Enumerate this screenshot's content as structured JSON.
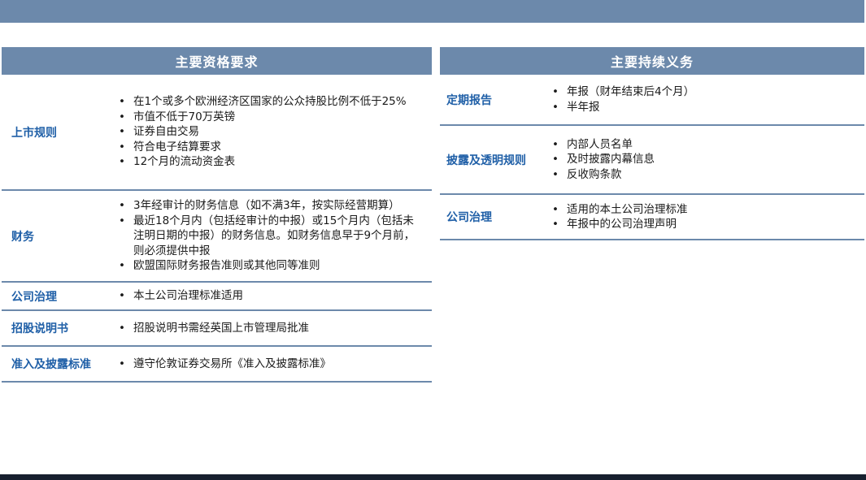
{
  "left_panel": {
    "title": "主要资格要求",
    "rows": [
      {
        "label": "上市规则",
        "items": [
          "在1个或多个欧洲经济区国家的公众持股比例不低于25%",
          "市值不低于70万英镑",
          "证券自由交易",
          "符合电子结算要求",
          "12个月的流动资金表"
        ]
      },
      {
        "label": "财务",
        "items": [
          "3年经审计的财务信息（如不满3年，按实际经营期算）",
          "最近18个月内（包括经审计的中报）或15个月内（包括未注明日期的中报）的财务信息。如财务信息早于9个月前，则必须提供中报",
          "欧盟国际财务报告准则或其他同等准则"
        ]
      },
      {
        "label": "公司治理",
        "items": [
          "本土公司治理标准适用"
        ]
      },
      {
        "label": "招股说明书",
        "items": [
          "招股说明书需经英国上市管理局批准"
        ]
      },
      {
        "label": "准入及披露标准",
        "items": [
          "遵守伦敦证券交易所《准入及披露标准》"
        ]
      }
    ]
  },
  "right_panel": {
    "title": "主要持续义务",
    "rows": [
      {
        "label": "定期报告",
        "items": [
          "年报（财年结束后4个月）",
          "半年报"
        ]
      },
      {
        "label": "披露及透明规则",
        "items": [
          "内部人员名单",
          "及时披露内幕信息",
          "反收购条款"
        ]
      },
      {
        "label": "公司治理",
        "items": [
          "适用的本土公司治理标准",
          "年报中的公司治理声明"
        ]
      }
    ]
  }
}
